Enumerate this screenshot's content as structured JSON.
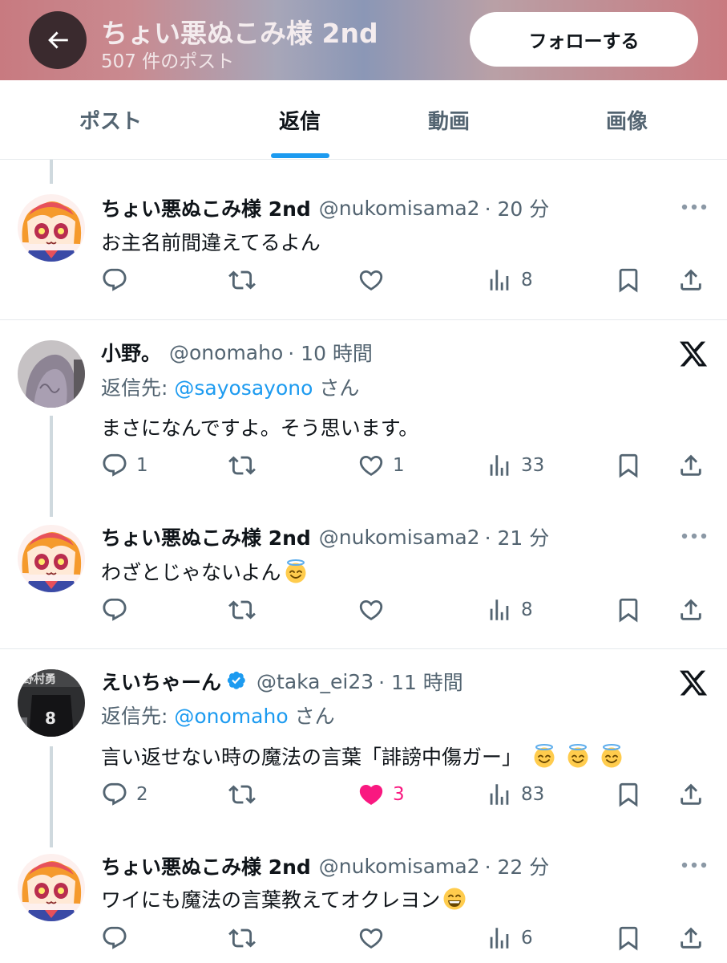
{
  "header": {
    "title": "ちょい悪ぬこみ様 2nd",
    "post_count": "507 件のポスト",
    "follow_label": "フォローする"
  },
  "tabs": [
    {
      "label": "ポスト",
      "active": false
    },
    {
      "label": "返信",
      "active": true
    },
    {
      "label": "動画",
      "active": false
    },
    {
      "label": "画像",
      "active": false
    }
  ],
  "posts": [
    {
      "name": "ちょい悪ぬこみ様 2nd",
      "handle": "@nukomisama2",
      "time": "· 20 分",
      "text": "お主名前間違えてるよん",
      "replies": "",
      "likes": "",
      "views": "8"
    },
    {
      "name": "小野。",
      "handle": "@onomaho",
      "time": "· 10 時間",
      "reply_prefix": "返信先: ",
      "reply_to": "@sayosayono",
      "reply_suffix": " さん",
      "text": "まさになんですよ。そう思います。",
      "replies": "1",
      "likes": "1",
      "views": "33"
    },
    {
      "name": "ちょい悪ぬこみ様 2nd",
      "handle": "@nukomisama2",
      "time": "· 21 分",
      "text": "わざとじゃないよん",
      "replies": "",
      "likes": "",
      "views": "8"
    },
    {
      "name": "えいちゃーん",
      "handle": "@taka_ei23",
      "time": "· 11 時間",
      "verified": true,
      "reply_prefix": "返信先: ",
      "reply_to": "@onomaho",
      "reply_suffix": " さん",
      "text": "言い返せない時の魔法の言葉「誹謗中傷ガー」",
      "replies": "2",
      "likes": "3",
      "liked": true,
      "views": "83"
    },
    {
      "name": "ちょい悪ぬこみ様 2nd",
      "handle": "@nukomisama2",
      "time": "· 22 分",
      "text": "ワイにも魔法の言葉教えてオクレヨン",
      "replies": "",
      "likes": "",
      "views": "6"
    }
  ],
  "colors": {
    "accent": "#1d9bf0",
    "like": "#f91880",
    "text": "#0f1419",
    "muted": "#536471"
  },
  "icons": [
    "back-arrow-icon",
    "more-icon",
    "x-logo-icon",
    "reply-icon",
    "retweet-icon",
    "like-icon",
    "views-icon",
    "bookmark-icon",
    "share-icon",
    "verified-badge-icon",
    "halo-smile-emoji",
    "grin-emoji"
  ]
}
